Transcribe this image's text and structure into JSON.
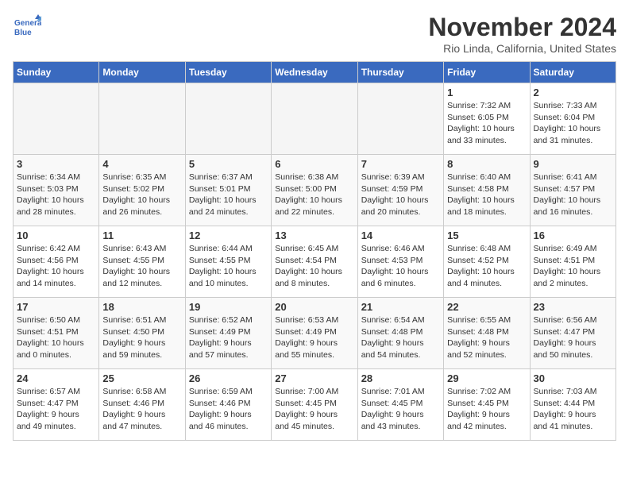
{
  "header": {
    "logo_line1": "General",
    "logo_line2": "Blue",
    "month": "November 2024",
    "location": "Rio Linda, California, United States"
  },
  "weekdays": [
    "Sunday",
    "Monday",
    "Tuesday",
    "Wednesday",
    "Thursday",
    "Friday",
    "Saturday"
  ],
  "weeks": [
    [
      {
        "day": "",
        "info": ""
      },
      {
        "day": "",
        "info": ""
      },
      {
        "day": "",
        "info": ""
      },
      {
        "day": "",
        "info": ""
      },
      {
        "day": "",
        "info": ""
      },
      {
        "day": "1",
        "info": "Sunrise: 7:32 AM\nSunset: 6:05 PM\nDaylight: 10 hours\nand 33 minutes."
      },
      {
        "day": "2",
        "info": "Sunrise: 7:33 AM\nSunset: 6:04 PM\nDaylight: 10 hours\nand 31 minutes."
      }
    ],
    [
      {
        "day": "3",
        "info": "Sunrise: 6:34 AM\nSunset: 5:03 PM\nDaylight: 10 hours\nand 28 minutes."
      },
      {
        "day": "4",
        "info": "Sunrise: 6:35 AM\nSunset: 5:02 PM\nDaylight: 10 hours\nand 26 minutes."
      },
      {
        "day": "5",
        "info": "Sunrise: 6:37 AM\nSunset: 5:01 PM\nDaylight: 10 hours\nand 24 minutes."
      },
      {
        "day": "6",
        "info": "Sunrise: 6:38 AM\nSunset: 5:00 PM\nDaylight: 10 hours\nand 22 minutes."
      },
      {
        "day": "7",
        "info": "Sunrise: 6:39 AM\nSunset: 4:59 PM\nDaylight: 10 hours\nand 20 minutes."
      },
      {
        "day": "8",
        "info": "Sunrise: 6:40 AM\nSunset: 4:58 PM\nDaylight: 10 hours\nand 18 minutes."
      },
      {
        "day": "9",
        "info": "Sunrise: 6:41 AM\nSunset: 4:57 PM\nDaylight: 10 hours\nand 16 minutes."
      }
    ],
    [
      {
        "day": "10",
        "info": "Sunrise: 6:42 AM\nSunset: 4:56 PM\nDaylight: 10 hours\nand 14 minutes."
      },
      {
        "day": "11",
        "info": "Sunrise: 6:43 AM\nSunset: 4:55 PM\nDaylight: 10 hours\nand 12 minutes."
      },
      {
        "day": "12",
        "info": "Sunrise: 6:44 AM\nSunset: 4:55 PM\nDaylight: 10 hours\nand 10 minutes."
      },
      {
        "day": "13",
        "info": "Sunrise: 6:45 AM\nSunset: 4:54 PM\nDaylight: 10 hours\nand 8 minutes."
      },
      {
        "day": "14",
        "info": "Sunrise: 6:46 AM\nSunset: 4:53 PM\nDaylight: 10 hours\nand 6 minutes."
      },
      {
        "day": "15",
        "info": "Sunrise: 6:48 AM\nSunset: 4:52 PM\nDaylight: 10 hours\nand 4 minutes."
      },
      {
        "day": "16",
        "info": "Sunrise: 6:49 AM\nSunset: 4:51 PM\nDaylight: 10 hours\nand 2 minutes."
      }
    ],
    [
      {
        "day": "17",
        "info": "Sunrise: 6:50 AM\nSunset: 4:51 PM\nDaylight: 10 hours\nand 0 minutes."
      },
      {
        "day": "18",
        "info": "Sunrise: 6:51 AM\nSunset: 4:50 PM\nDaylight: 9 hours\nand 59 minutes."
      },
      {
        "day": "19",
        "info": "Sunrise: 6:52 AM\nSunset: 4:49 PM\nDaylight: 9 hours\nand 57 minutes."
      },
      {
        "day": "20",
        "info": "Sunrise: 6:53 AM\nSunset: 4:49 PM\nDaylight: 9 hours\nand 55 minutes."
      },
      {
        "day": "21",
        "info": "Sunrise: 6:54 AM\nSunset: 4:48 PM\nDaylight: 9 hours\nand 54 minutes."
      },
      {
        "day": "22",
        "info": "Sunrise: 6:55 AM\nSunset: 4:48 PM\nDaylight: 9 hours\nand 52 minutes."
      },
      {
        "day": "23",
        "info": "Sunrise: 6:56 AM\nSunset: 4:47 PM\nDaylight: 9 hours\nand 50 minutes."
      }
    ],
    [
      {
        "day": "24",
        "info": "Sunrise: 6:57 AM\nSunset: 4:47 PM\nDaylight: 9 hours\nand 49 minutes."
      },
      {
        "day": "25",
        "info": "Sunrise: 6:58 AM\nSunset: 4:46 PM\nDaylight: 9 hours\nand 47 minutes."
      },
      {
        "day": "26",
        "info": "Sunrise: 6:59 AM\nSunset: 4:46 PM\nDaylight: 9 hours\nand 46 minutes."
      },
      {
        "day": "27",
        "info": "Sunrise: 7:00 AM\nSunset: 4:45 PM\nDaylight: 9 hours\nand 45 minutes."
      },
      {
        "day": "28",
        "info": "Sunrise: 7:01 AM\nSunset: 4:45 PM\nDaylight: 9 hours\nand 43 minutes."
      },
      {
        "day": "29",
        "info": "Sunrise: 7:02 AM\nSunset: 4:45 PM\nDaylight: 9 hours\nand 42 minutes."
      },
      {
        "day": "30",
        "info": "Sunrise: 7:03 AM\nSunset: 4:44 PM\nDaylight: 9 hours\nand 41 minutes."
      }
    ]
  ]
}
